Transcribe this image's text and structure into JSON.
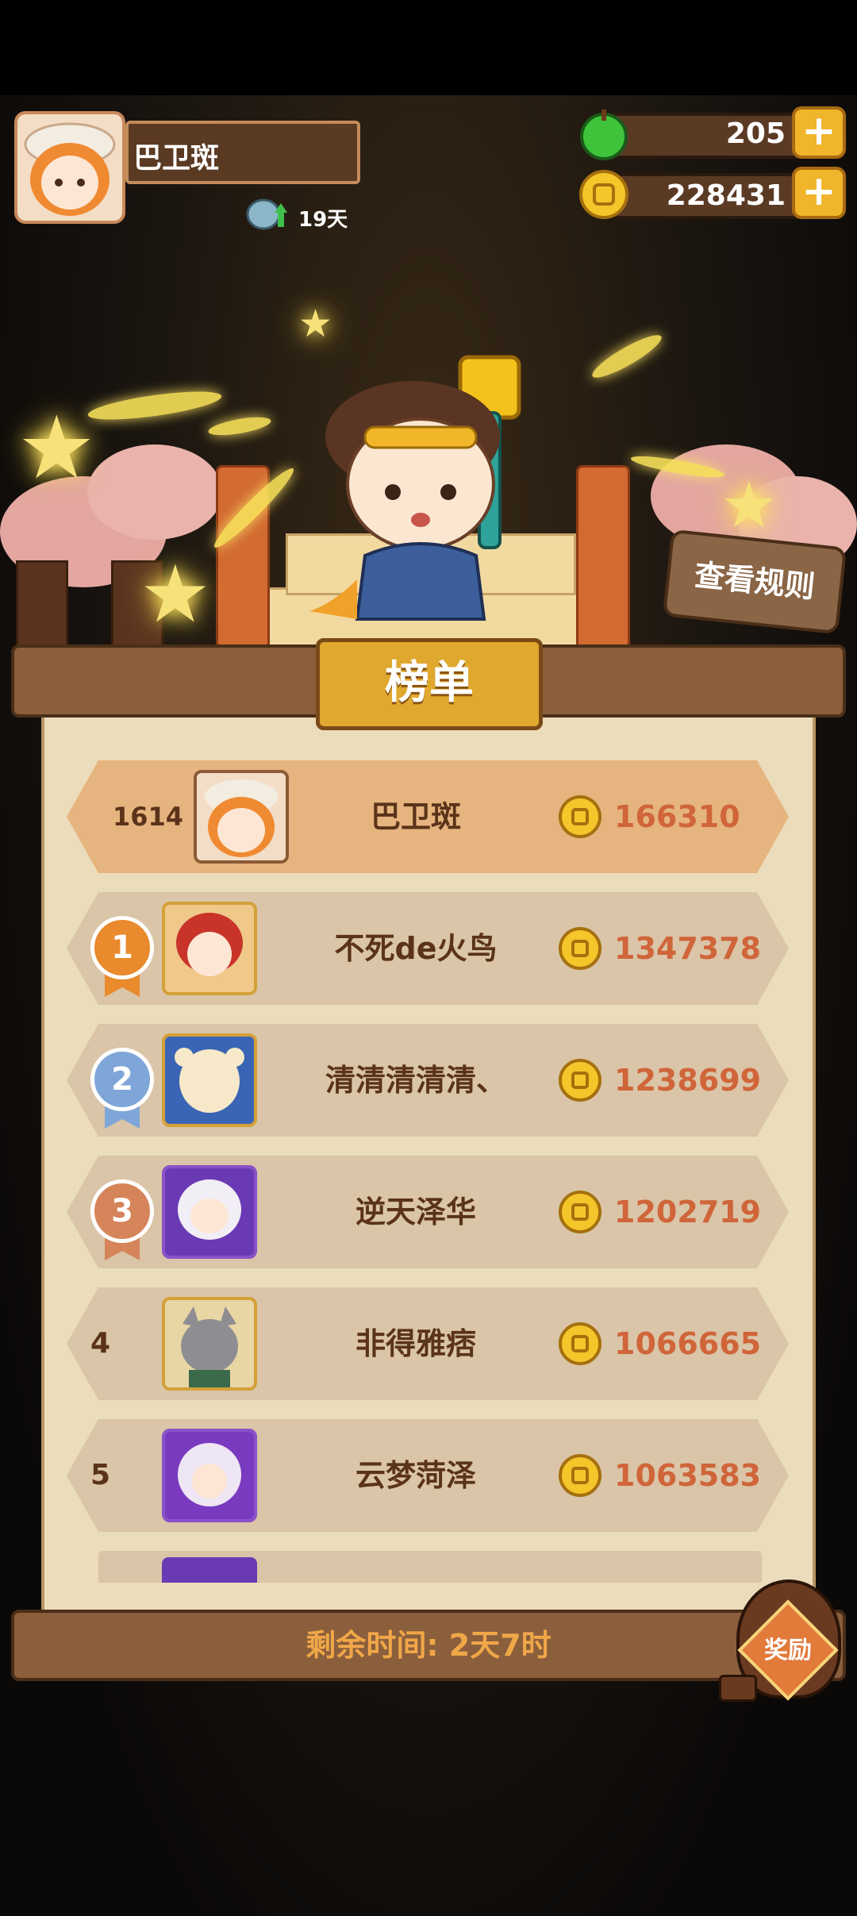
{
  "player": {
    "name": "巴卫斑",
    "days": "19天"
  },
  "currency": {
    "gems": "205",
    "coins": "228431"
  },
  "buttons": {
    "rules": "查看规则",
    "reward": "奖励"
  },
  "board": {
    "title": "榜单",
    "self_row": {
      "rank": "1614",
      "name": "巴卫斑",
      "score": "166310"
    },
    "rows": [
      {
        "rank": "1",
        "name": "不死de火鸟",
        "score": "1347378"
      },
      {
        "rank": "2",
        "name": "清清清清清、",
        "score": "1238699"
      },
      {
        "rank": "3",
        "name": "逆天泽华",
        "score": "1202719"
      },
      {
        "rank": "4",
        "name": "非得雅痞",
        "score": "1066665"
      },
      {
        "rank": "5",
        "name": "云梦菏泽",
        "score": "1063583"
      }
    ],
    "time_remaining": "剩余时间: 2天7时"
  },
  "colors": {
    "gold": "#f0b52a",
    "wood": "#8b5f3c",
    "paper": "#ebdcbb",
    "score": "#d0653a",
    "medal_gold": "#e98a2c",
    "medal_silver": "#7fa6d8",
    "medal_bronze": "#d6845a"
  }
}
